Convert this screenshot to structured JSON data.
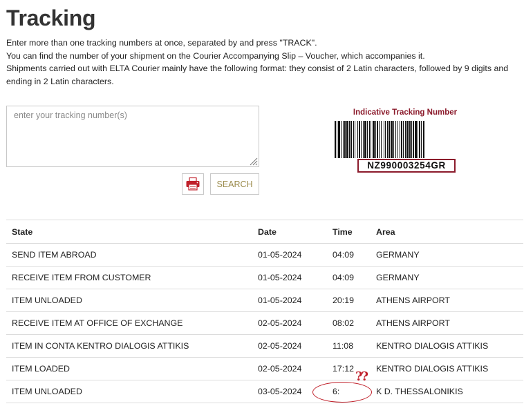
{
  "page": {
    "title": "Tracking",
    "intro_lines": [
      "Enter more than one tracking numbers at once, separated by and press \"TRACK\".",
      "You can find the number of your shipment on the Courier Accompanying Slip – Voucher, which accompanies it.",
      "Shipments carried out with ELTA Courier mainly have the following format: they consist of 2 Latin characters, followed by 9 digits and ending in 2 Latin characters."
    ]
  },
  "form": {
    "input_value": "",
    "input_placeholder": "enter your tracking number(s)",
    "print_icon": "printer-icon",
    "search_label": "SEARCH"
  },
  "barcode": {
    "caption": "Indicative Tracking Number",
    "number": "NZ990003254GR"
  },
  "table": {
    "headers": {
      "state": "State",
      "date": "Date",
      "time": "Time",
      "area": "Area"
    },
    "rows": [
      {
        "state": "SEND ITEM ABROAD",
        "date": "01-05-2024",
        "time": "04:09",
        "area": "GERMANY"
      },
      {
        "state": "RECEIVE ITEM FROM CUSTOMER",
        "date": "01-05-2024",
        "time": "04:09",
        "area": "GERMANY"
      },
      {
        "state": "ITEM UNLOADED",
        "date": "01-05-2024",
        "time": "20:19",
        "area": "ATHENS AIRPORT"
      },
      {
        "state": "RECEIVE ITEM AT OFFICE OF EXCHANGE",
        "date": "02-05-2024",
        "time": "08:02",
        "area": "ATHENS AIRPORT"
      },
      {
        "state": "ITEM IN CONTA KENTRO DIALOGIS ATTIKIS",
        "date": "02-05-2024",
        "time": "11:08",
        "area": "KENTRO DIALOGIS ATTIKIS"
      },
      {
        "state": "ITEM LOADED",
        "date": "02-05-2024",
        "time": "17:12",
        "area": "KENTRO DIALOGIS ATTIKIS"
      },
      {
        "state": "ITEM UNLOADED",
        "date": "03-05-2024",
        "time": "6:",
        "area": "K D. THESSALONIKIS"
      }
    ]
  },
  "annotation": {
    "marks": "??",
    "color": "#c0202a"
  },
  "colors": {
    "brand": "#8b1a2b",
    "print_icon": "#c0202a",
    "search_text": "#9a8a4a"
  }
}
